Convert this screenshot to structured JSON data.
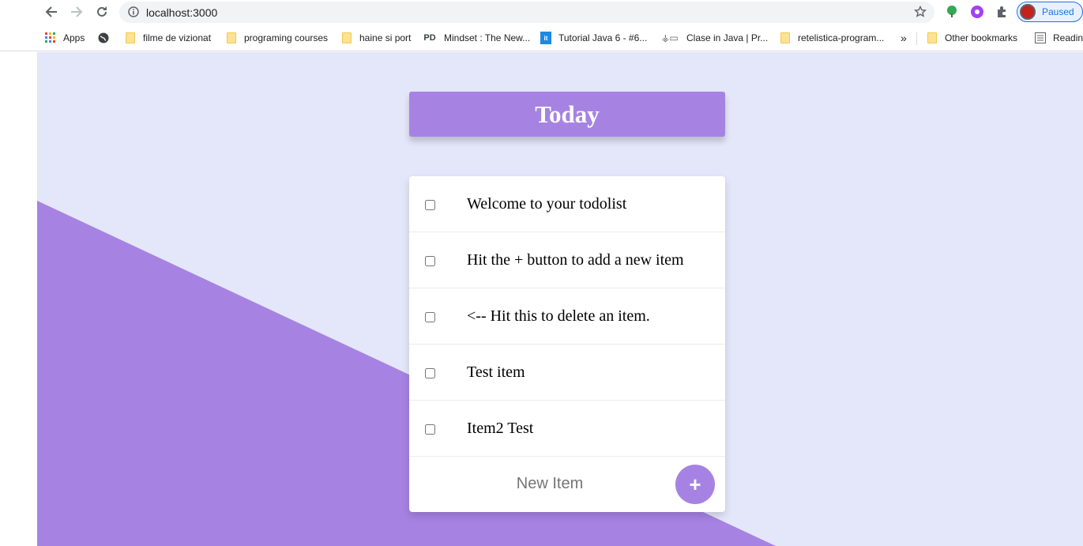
{
  "browser": {
    "url": "localhost:3000",
    "profile_status": "Paused",
    "bookmarks": [
      {
        "label": "Apps",
        "icon": "apps-grid-icon"
      },
      {
        "label": "",
        "icon": "globe-icon"
      },
      {
        "label": "filme de vizionat",
        "icon": "folder-icon"
      },
      {
        "label": "programing courses",
        "icon": "folder-icon"
      },
      {
        "label": "haine si port",
        "icon": "folder-icon"
      },
      {
        "label": "Mindset : The New...",
        "icon": "pd-icon"
      },
      {
        "label": "Tutorial Java 6 - #6...",
        "icon": "itc-icon"
      },
      {
        "label": "Clase in Java | Pr...",
        "icon": "site-icon"
      },
      {
        "label": "retelistica-program...",
        "icon": "folder-icon"
      }
    ],
    "overflow_chevron": "»",
    "other_bookmarks": "Other bookmarks",
    "reading_list": "Readin"
  },
  "app": {
    "title": "Today",
    "items": [
      {
        "text": "Welcome to your todolist",
        "checked": false
      },
      {
        "text": "Hit the + button to add a new item",
        "checked": false
      },
      {
        "text": "<-- Hit this to delete an item.",
        "checked": false
      },
      {
        "text": "Test item",
        "checked": false
      },
      {
        "text": "Item2 Test",
        "checked": false
      }
    ],
    "new_item_placeholder": "New Item",
    "add_button_label": "+"
  },
  "colors": {
    "accent": "#a683e3",
    "background": "#e4e6fa"
  }
}
